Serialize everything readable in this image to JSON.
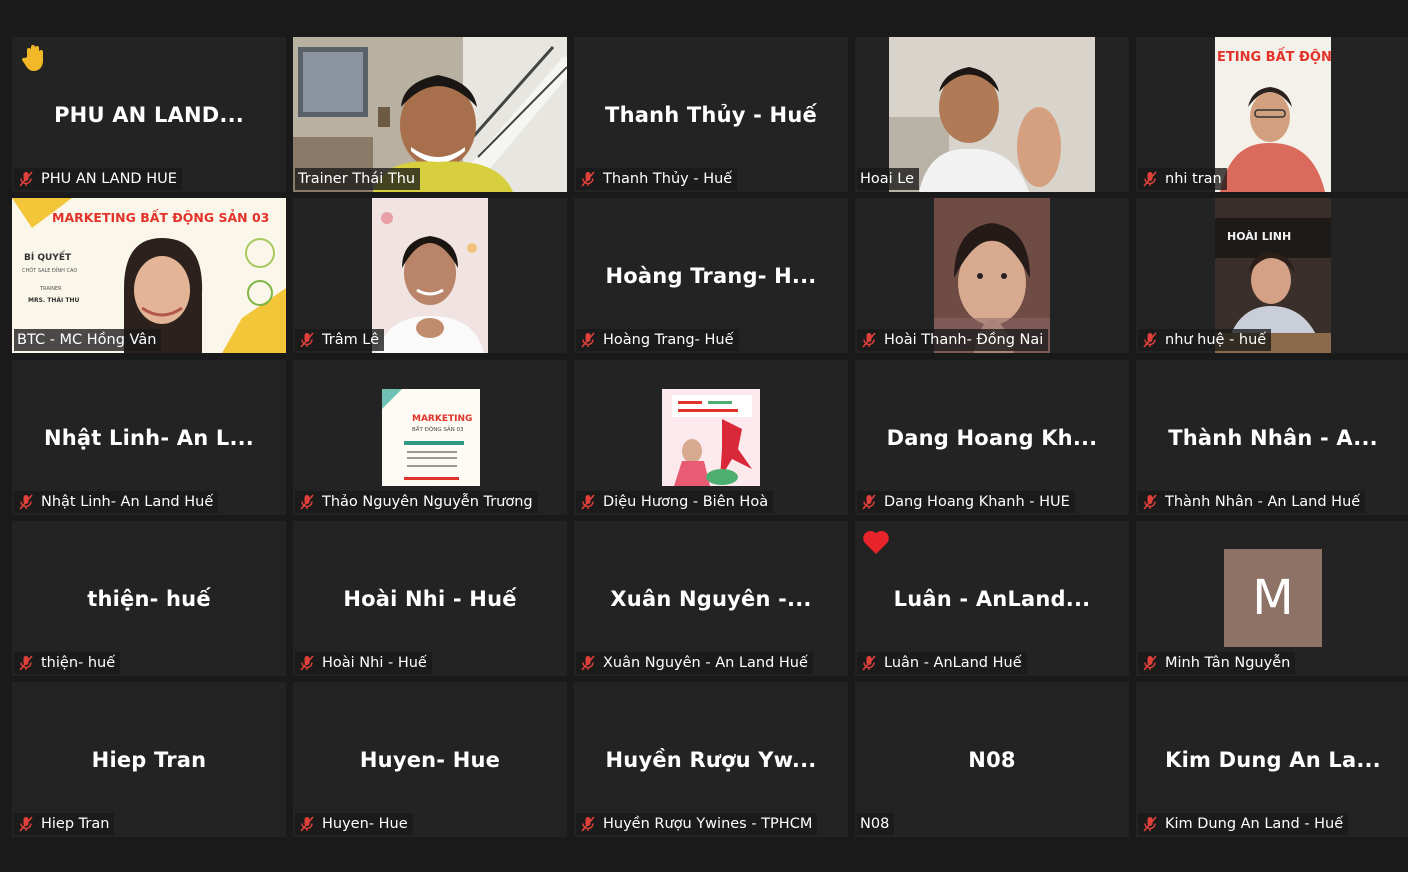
{
  "meeting": {
    "participants": [
      {
        "display": "PHU AN LAND...",
        "name": "PHU AN LAND HUE",
        "muted": true,
        "reaction": "raised-hand-icon"
      },
      {
        "display": "",
        "name": "Trainer Thái Thu",
        "muted": false,
        "active_speaker": true
      },
      {
        "display": "Thanh Thủy - Huế",
        "name": "Thanh Thủy - Huế",
        "muted": true
      },
      {
        "display": "",
        "name": "Hoai Le",
        "muted": false
      },
      {
        "display": "",
        "name": "nhi tran",
        "muted": true,
        "poster_text": "ETING BẤT ĐỘNG S"
      },
      {
        "display": "",
        "name": "BTC - MC Hồng Vân",
        "muted": false,
        "poster_text": "MARKETING BẤT ĐỘNG SẢN 03",
        "poster_lines": [
          "BÍ QUYẾT",
          "CHỐT SALE ĐỈNH CAO",
          "TRAINER",
          "MRS. THÁI THU"
        ]
      },
      {
        "display": "",
        "name": "Trâm Lê",
        "muted": true
      },
      {
        "display": "Hoàng Trang- H...",
        "name": "Hoàng Trang- Huế",
        "muted": true
      },
      {
        "display": "",
        "name": "Hoài Thanh- Đồng Nai",
        "muted": true
      },
      {
        "display": "",
        "name": "như huệ - huế",
        "muted": true,
        "poster_text": "HOÀI LINH"
      },
      {
        "display": "Nhật Linh- An L...",
        "name": "Nhật Linh- An Land Huế",
        "muted": true
      },
      {
        "display": "",
        "name": "Thảo Nguyên Nguyễn Trương",
        "muted": true,
        "poster_text": "MARKETING",
        "poster_sub": "BẤT ĐỘNG SẢN 03"
      },
      {
        "display": "",
        "name": "Diệu Hương - Biên Hoà",
        "muted": true
      },
      {
        "display": "Dang Hoang Kh...",
        "name": "Dang Hoang Khanh - HUE",
        "muted": true
      },
      {
        "display": "Thành Nhân - A...",
        "name": "Thành Nhân - An Land Huế",
        "muted": true
      },
      {
        "display": "thiện- huế",
        "name": "thiện- huế",
        "muted": true
      },
      {
        "display": "Hoài Nhi - Huế",
        "name": "Hoài Nhi - Huế",
        "muted": true
      },
      {
        "display": "Xuân Nguyên -...",
        "name": "Xuân Nguyên - An Land Huế",
        "muted": true
      },
      {
        "display": "Luân - AnLand...",
        "name": "Luân - AnLand Huế",
        "muted": true,
        "reaction": "heart-icon"
      },
      {
        "display": "",
        "name": "Minh Tân Nguyễn",
        "muted": true,
        "avatar_letter": "M"
      },
      {
        "display": "Hiep Tran",
        "name": "Hiep Tran",
        "muted": true
      },
      {
        "display": "Huyen- Hue",
        "name": "Huyen- Hue",
        "muted": true
      },
      {
        "display": "Huyền Rượu Yw...",
        "name": "Huyền Rượu Ywines - TPHCM",
        "muted": true
      },
      {
        "display": "N08",
        "name": "N08",
        "muted": false
      },
      {
        "display": "Kim Dung An La...",
        "name": "Kim Dung An Land - Huế",
        "muted": true
      }
    ]
  },
  "colors": {
    "background": "#1a1a1a",
    "tile": "#232323",
    "active_speaker_border": "#d9ec68",
    "muted_icon": "#e0403a",
    "avatar_bg": "#8f7266",
    "heart": "#e8242b",
    "raised_hand": "#f2b827"
  }
}
